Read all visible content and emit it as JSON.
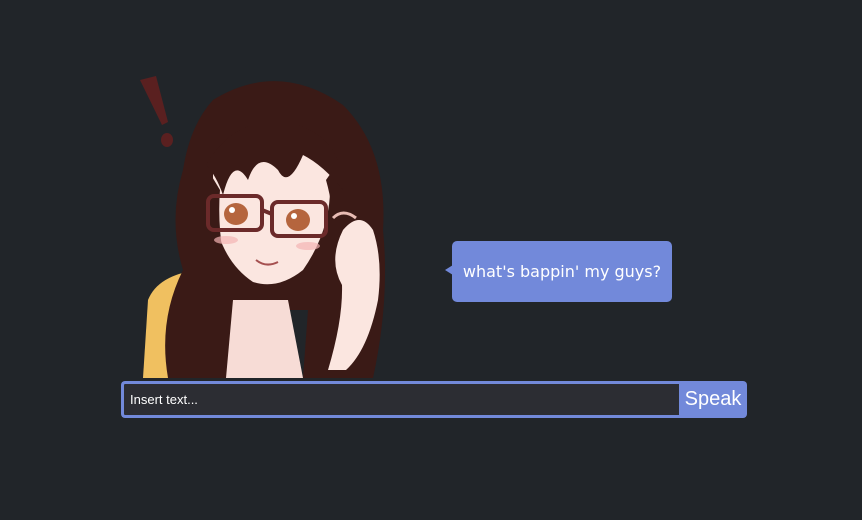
{
  "theme": {
    "background": "#212529",
    "accent": "#7289da",
    "input_background": "#2c2d33",
    "text": "#ffffff"
  },
  "character": {
    "icon": "anime-girl-with-glasses-icon"
  },
  "speech_bubble": {
    "text": "what's bappin' my guys?"
  },
  "input": {
    "placeholder": "Insert text...",
    "value": ""
  },
  "speak_button": {
    "label": "Speak"
  }
}
